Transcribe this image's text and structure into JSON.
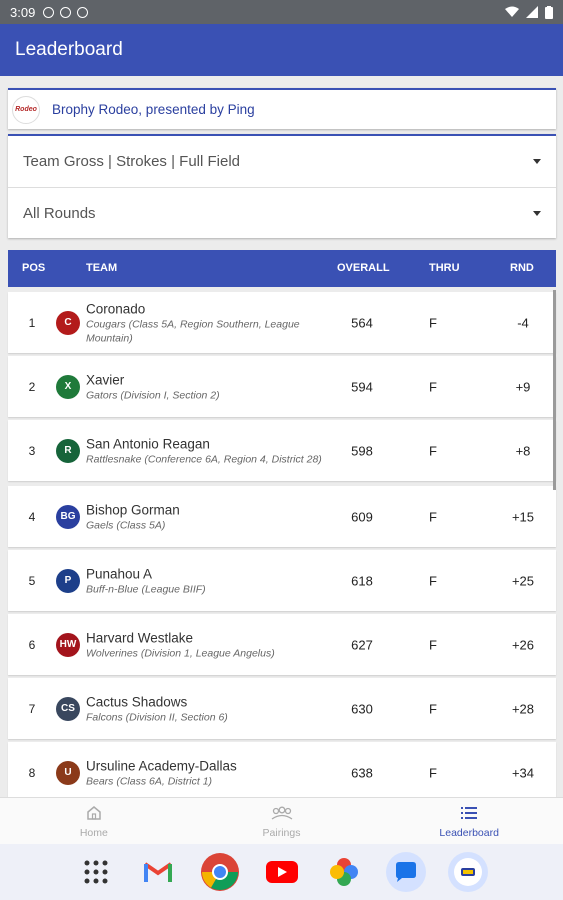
{
  "statusbar": {
    "time": "3:09"
  },
  "appbar": {
    "title": "Leaderboard"
  },
  "event": {
    "logo_text": "Rodeo",
    "title": "Brophy Rodeo, presented by Ping"
  },
  "filters": {
    "type": "Team Gross | Strokes | Full Field",
    "rounds": "All Rounds"
  },
  "table": {
    "headers": {
      "pos": "POS",
      "team": "TEAM",
      "overall": "OVERALL",
      "thru": "THRU",
      "rnd": "RND"
    },
    "rows": [
      {
        "pos": "1",
        "team": "Coronado",
        "sub": "Cougars (Class 5A, Region Southern, League Mountain)",
        "overall": "564",
        "thru": "F",
        "rnd": "-4",
        "logo_color": "#b31b1b",
        "logo_text": "C"
      },
      {
        "pos": "2",
        "team": "Xavier",
        "sub": "Gators (Division I, Section 2)",
        "overall": "594",
        "thru": "F",
        "rnd": "+9",
        "logo_color": "#1f7a3a",
        "logo_text": "X"
      },
      {
        "pos": "3",
        "team": "San Antonio Reagan",
        "sub": "Rattlesnake (Conference 6A, Region 4, District 28)",
        "overall": "598",
        "thru": "F",
        "rnd": "+8",
        "logo_color": "#16643a",
        "logo_text": "R"
      },
      {
        "pos": "4",
        "team": "Bishop Gorman",
        "sub": "Gaels (Class 5A)",
        "overall": "609",
        "thru": "F",
        "rnd": "+15",
        "logo_color": "#2a3f9f",
        "logo_text": "BG"
      },
      {
        "pos": "5",
        "team": "Punahou A",
        "sub": "Buff-n-Blue (League BIIF)",
        "overall": "618",
        "thru": "F",
        "rnd": "+25",
        "logo_color": "#1d3f8a",
        "logo_text": "P"
      },
      {
        "pos": "6",
        "team": "Harvard Westlake",
        "sub": "Wolverines (Division 1, League Angelus)",
        "overall": "627",
        "thru": "F",
        "rnd": "+26",
        "logo_color": "#a3141c",
        "logo_text": "HW"
      },
      {
        "pos": "7",
        "team": "Cactus Shadows",
        "sub": "Falcons (Division II, Section 6)",
        "overall": "630",
        "thru": "F",
        "rnd": "+28",
        "logo_color": "#39475e",
        "logo_text": "CS"
      },
      {
        "pos": "8",
        "team": "Ursuline Academy-Dallas",
        "sub": "Bears (Class 6A, District 1)",
        "overall": "638",
        "thru": "F",
        "rnd": "+34",
        "logo_color": "#8b3a1a",
        "logo_text": "U"
      }
    ]
  },
  "bottomnav": {
    "home": "Home",
    "pairings": "Pairings",
    "leaderboard": "Leaderboard"
  },
  "dock": [
    "apps-grid-icon",
    "gmail-icon",
    "chrome-icon",
    "youtube-icon",
    "photos-icon",
    "messages-icon",
    "golf-app-icon"
  ],
  "colors": {
    "primary": "#3a51b4",
    "statusbar": "#5f6368",
    "background": "#ececec"
  }
}
